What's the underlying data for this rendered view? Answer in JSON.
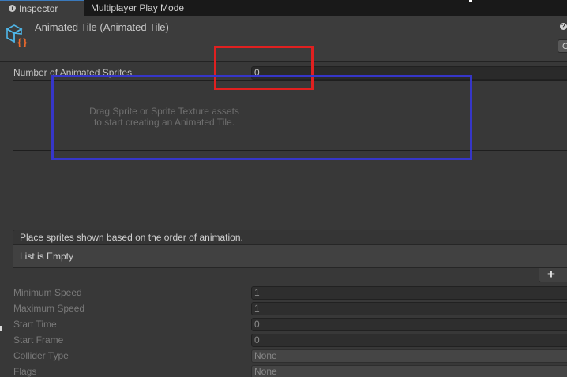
{
  "tabs": {
    "inspector_icon": "i",
    "inspector": "Inspector",
    "multiplayer": "Multiplayer Play Mode"
  },
  "header": {
    "title": "Animated Tile (Animated Tile)",
    "icon": "animated-tile-icon",
    "help_glyph": "?",
    "open_button_label": "O"
  },
  "number_of_sprites": {
    "label": "Number of Animated Sprites",
    "value": "0"
  },
  "drop_area": {
    "line1": "Drag Sprite or Sprite Texture assets",
    "line2": "to start creating an Animated Tile."
  },
  "sprite_list": {
    "header": "Place sprites shown based on the order of animation.",
    "empty_text": "List is Empty",
    "add_label": "+"
  },
  "properties": [
    {
      "label": "Minimum Speed",
      "value": "1"
    },
    {
      "label": "Maximum Speed",
      "value": "1"
    },
    {
      "label": "Start Time",
      "value": "0"
    },
    {
      "label": "Start Frame",
      "value": "0"
    },
    {
      "label": "Collider Type",
      "value": "None"
    },
    {
      "label": "Flags",
      "value": "None"
    }
  ],
  "colors": {
    "annotation_red": "#e02020",
    "annotation_blue": "#3636c8",
    "icon_blue": "#4fb6e8",
    "icon_orange": "#ef6a2c"
  }
}
